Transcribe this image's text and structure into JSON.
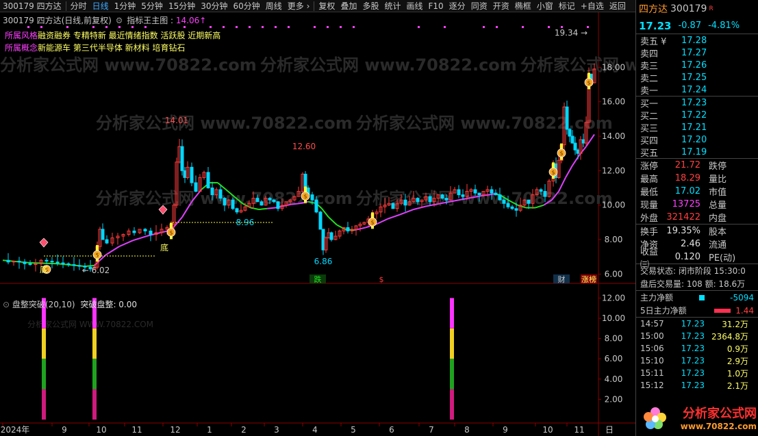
{
  "toolbar": {
    "code_name": "300179 四方达",
    "items": [
      "分时",
      "日线",
      "1分钟",
      "5分钟",
      "15分钟",
      "30分钟",
      "60分钟",
      "周线",
      "更多 ›"
    ],
    "active_index": 1,
    "tools": [
      "复权",
      "叠加",
      "多股",
      "统计",
      "画线",
      "F10",
      "逐分",
      "同资",
      "开资",
      "椭框",
      "小窗",
      "标记",
      "+自选",
      "返回"
    ]
  },
  "chart_header": {
    "title": "300179 四方达(日线,前复权)",
    "indicator_label": "指标王主图 :",
    "indicator_value": "14.06↑"
  },
  "concepts": {
    "style_label": "所属风格",
    "style_tags": "融资融券  专精特新  最近情绪指数  活跃股  近期新高",
    "concept_label": "所属概念",
    "concept_tags": "新能源车  第三代半导体  新材料  培育钻石"
  },
  "chart_data": [
    {
      "type": "candlestick",
      "title": "300179 四方达(日线,前复权)",
      "y_ticks": [
        18.0,
        16.0,
        14.0,
        12.0,
        10.0,
        8.0,
        6.0
      ],
      "ylim": [
        5.5,
        19.6
      ],
      "x_ticks": [
        "2024年",
        "9",
        "10",
        "11",
        "12",
        "1",
        "2",
        "3",
        "4",
        "5",
        "6",
        "7",
        "8",
        "9",
        "10",
        "11",
        "日"
      ],
      "annotations": {
        "high_1": "14.01",
        "high_2": "12.60",
        "low_1": "6.02",
        "low_2": "6.86",
        "support": "8.96",
        "recent_high": "19.34"
      },
      "bottom_labels": [
        "底",
        "底"
      ],
      "event_labels": [
        "跌",
        "$",
        "财",
        "涨榜"
      ],
      "close_path": [
        [
          0,
          6.8
        ],
        [
          8,
          6.7
        ],
        [
          16,
          6.75
        ],
        [
          24,
          6.7
        ],
        [
          32,
          6.6
        ],
        [
          40,
          6.55
        ],
        [
          48,
          6.6
        ],
        [
          56,
          6.8
        ],
        [
          64,
          6.75
        ],
        [
          72,
          6.7
        ],
        [
          80,
          6.65
        ],
        [
          88,
          6.6
        ],
        [
          96,
          6.55
        ],
        [
          104,
          6.5
        ],
        [
          112,
          6.45
        ],
        [
          120,
          6.4
        ],
        [
          128,
          6.3
        ],
        [
          134,
          6.4
        ],
        [
          138,
          7.6
        ],
        [
          142,
          8.6
        ],
        [
          146,
          8.0
        ],
        [
          152,
          7.8
        ],
        [
          160,
          8.1
        ],
        [
          168,
          8.2
        ],
        [
          176,
          8.3
        ],
        [
          184,
          8.5
        ],
        [
          192,
          8.4
        ],
        [
          200,
          8.6
        ],
        [
          208,
          8.5
        ],
        [
          216,
          8.3
        ],
        [
          224,
          8.4
        ],
        [
          232,
          8.6
        ],
        [
          240,
          8.7
        ],
        [
          246,
          8.9
        ],
        [
          250,
          10.0
        ],
        [
          254,
          12.5
        ],
        [
          258,
          13.4
        ],
        [
          262,
          12.0
        ],
        [
          266,
          11.6
        ],
        [
          270,
          12.2
        ],
        [
          276,
          11.3
        ],
        [
          282,
          10.8
        ],
        [
          288,
          11.6
        ],
        [
          294,
          11.9
        ],
        [
          300,
          11.0
        ],
        [
          306,
          10.6
        ],
        [
          312,
          10.9
        ],
        [
          318,
          10.4
        ],
        [
          324,
          10.0
        ],
        [
          330,
          10.3
        ],
        [
          336,
          9.8
        ],
        [
          342,
          9.6
        ],
        [
          348,
          9.7
        ],
        [
          354,
          9.9
        ],
        [
          360,
          10.1
        ],
        [
          366,
          10.4
        ],
        [
          372,
          10.2
        ],
        [
          378,
          10.0
        ],
        [
          384,
          10.4
        ],
        [
          390,
          10.3
        ],
        [
          396,
          10.2
        ],
        [
          402,
          9.8
        ],
        [
          408,
          10.0
        ],
        [
          414,
          10.2
        ],
        [
          420,
          10.3
        ],
        [
          426,
          10.5
        ],
        [
          432,
          10.8
        ],
        [
          438,
          11.8
        ],
        [
          442,
          11.0
        ],
        [
          446,
          10.6
        ],
        [
          452,
          10.3
        ],
        [
          458,
          9.6
        ],
        [
          464,
          8.6
        ],
        [
          468,
          7.4
        ],
        [
          472,
          8.1
        ],
        [
          476,
          8.4
        ],
        [
          480,
          8.0
        ],
        [
          486,
          8.2
        ],
        [
          492,
          8.5
        ],
        [
          498,
          8.7
        ],
        [
          504,
          8.5
        ],
        [
          510,
          8.6
        ],
        [
          516,
          8.8
        ],
        [
          522,
          8.9
        ],
        [
          528,
          9.0
        ],
        [
          534,
          9.2
        ],
        [
          540,
          9.5
        ],
        [
          546,
          9.6
        ],
        [
          552,
          9.9
        ],
        [
          558,
          10.0
        ],
        [
          564,
          10.1
        ],
        [
          570,
          9.8
        ],
        [
          576,
          10.1
        ],
        [
          582,
          10.3
        ],
        [
          588,
          10.0
        ],
        [
          594,
          10.2
        ],
        [
          600,
          10.4
        ],
        [
          606,
          10.2
        ],
        [
          612,
          10.3
        ],
        [
          618,
          10.5
        ],
        [
          624,
          10.2
        ],
        [
          630,
          10.4
        ],
        [
          636,
          10.6
        ],
        [
          642,
          10.4
        ],
        [
          648,
          10.3
        ],
        [
          654,
          10.7
        ],
        [
          660,
          10.9
        ],
        [
          666,
          10.6
        ],
        [
          672,
          10.5
        ],
        [
          678,
          10.8
        ],
        [
          684,
          10.9
        ],
        [
          690,
          10.7
        ],
        [
          696,
          10.6
        ],
        [
          702,
          10.8
        ],
        [
          708,
          10.9
        ],
        [
          714,
          10.7
        ],
        [
          720,
          10.6
        ],
        [
          726,
          10.3
        ],
        [
          732,
          10.1
        ],
        [
          738,
          9.9
        ],
        [
          744,
          9.8
        ],
        [
          750,
          9.7
        ],
        [
          756,
          10.0
        ],
        [
          762,
          10.3
        ],
        [
          768,
          10.1
        ],
        [
          774,
          10.6
        ],
        [
          780,
          10.9
        ],
        [
          786,
          10.8
        ],
        [
          792,
          10.5
        ],
        [
          798,
          11.4
        ],
        [
          804,
          12.4
        ],
        [
          808,
          11.6
        ],
        [
          812,
          12.6
        ],
        [
          816,
          13.5
        ],
        [
          820,
          15.7
        ],
        [
          824,
          14.4
        ],
        [
          828,
          14.0
        ],
        [
          832,
          13.6
        ],
        [
          836,
          13.2
        ],
        [
          840,
          13.0
        ],
        [
          844,
          13.8
        ],
        [
          848,
          13.6
        ],
        [
          852,
          14.8
        ],
        [
          856,
          17.6
        ],
        [
          860,
          17.1
        ],
        [
          864,
          17.9
        ]
      ],
      "ma_line": [
        [
          0,
          6.8
        ],
        [
          40,
          6.65
        ],
        [
          80,
          6.6
        ],
        [
          120,
          6.45
        ],
        [
          134,
          6.5
        ],
        [
          150,
          7.1
        ],
        [
          170,
          7.6
        ],
        [
          190,
          7.95
        ],
        [
          210,
          8.2
        ],
        [
          230,
          8.4
        ],
        [
          246,
          8.55
        ],
        [
          262,
          9.3
        ],
        [
          276,
          10.2
        ],
        [
          290,
          10.9
        ],
        [
          302,
          11.3
        ],
        [
          314,
          11.3
        ],
        [
          326,
          10.9
        ],
        [
          338,
          10.5
        ],
        [
          350,
          10.1
        ],
        [
          362,
          9.85
        ],
        [
          374,
          9.75
        ],
        [
          386,
          9.8
        ],
        [
          398,
          9.85
        ],
        [
          410,
          9.95
        ],
        [
          422,
          10.05
        ],
        [
          434,
          10.1
        ],
        [
          446,
          10.2
        ],
        [
          458,
          10.1
        ],
        [
          466,
          9.8
        ],
        [
          476,
          9.3
        ],
        [
          488,
          8.85
        ],
        [
          500,
          8.6
        ],
        [
          514,
          8.55
        ],
        [
          530,
          8.7
        ],
        [
          546,
          8.9
        ],
        [
          562,
          9.2
        ],
        [
          580,
          9.45
        ],
        [
          600,
          9.75
        ],
        [
          620,
          9.95
        ],
        [
          640,
          10.1
        ],
        [
          660,
          10.25
        ],
        [
          680,
          10.4
        ],
        [
          700,
          10.55
        ],
        [
          718,
          10.65
        ],
        [
          726,
          10.6
        ],
        [
          738,
          10.3
        ],
        [
          752,
          10.0
        ],
        [
          764,
          9.85
        ],
        [
          778,
          9.85
        ],
        [
          790,
          10.0
        ],
        [
          802,
          10.3
        ],
        [
          812,
          10.8
        ],
        [
          822,
          11.6
        ],
        [
          832,
          12.3
        ],
        [
          842,
          12.9
        ],
        [
          852,
          13.4
        ],
        [
          864,
          14.1
        ]
      ],
      "ma_green_ranges": [
        [
          0,
          134
        ],
        [
          290,
          380
        ],
        [
          446,
          516
        ],
        [
          718,
          790
        ]
      ],
      "last_price": 17.23,
      "signals_x": [
        60,
        138,
        246,
        440,
        540,
        800,
        814,
        856
      ],
      "limit_up_x": [
        138,
        246,
        440,
        540,
        800,
        814,
        856
      ],
      "diamonds_x": [
        60,
        234
      ]
    },
    {
      "type": "bar",
      "title": "盘整突破(20,10)  突破盘整: 0.00",
      "y_ticks": [
        12.0,
        10.0,
        8.0,
        6.0,
        4.0,
        2.0
      ],
      "ylim": [
        0,
        12.5
      ],
      "bars_x": [
        60,
        134,
        656
      ],
      "bar_value": 12,
      "segments": [
        {
          "upto": 3,
          "color": "#d01a7e"
        },
        {
          "upto": 6,
          "color": "#1fa31f"
        },
        {
          "upto": 9,
          "color": "#f0d020"
        },
        {
          "upto": 12,
          "color": "#ff33ff"
        }
      ]
    }
  ],
  "panel2_title": "盘整突破(20,10)",
  "panel2_value": "突破盘整: 0.00",
  "watermark": "分析家公式网   WWW.70822.COM",
  "right_panel": {
    "name": "四方达",
    "code": "300179",
    "r_badge": "R",
    "last": "17.23",
    "change": "-0.87",
    "pct": "-4.81%",
    "sells": [
      {
        "label": "卖五 ¥",
        "price": "17.28"
      },
      {
        "label": "卖四",
        "price": "17.27"
      },
      {
        "label": "卖三",
        "price": "17.26"
      },
      {
        "label": "卖二",
        "price": "17.25"
      },
      {
        "label": "卖一",
        "price": "17.24"
      }
    ],
    "buys": [
      {
        "label": "买一",
        "price": "17.23"
      },
      {
        "label": "买二",
        "price": "17.22"
      },
      {
        "label": "买三",
        "price": "17.21"
      },
      {
        "label": "买四",
        "price": "17.20"
      },
      {
        "label": "买五",
        "price": "17.19"
      }
    ],
    "stats1": [
      {
        "l1": "涨停",
        "v1": "21.72",
        "c1": "red",
        "l2": "跌停"
      },
      {
        "l1": "最高",
        "v1": "18.29",
        "c1": "red",
        "l2": "量比"
      },
      {
        "l1": "最低",
        "v1": "17.02",
        "c1": "cyan",
        "l2": "市值"
      },
      {
        "l1": "现量",
        "v1": "13725",
        "c1": "mag2",
        "l2": "总量"
      },
      {
        "l1": "外盘",
        "v1": "321422",
        "c1": "red",
        "l2": "内盘"
      }
    ],
    "stats2": [
      {
        "l1": "换手",
        "v1": "19.35%",
        "c1": "white",
        "l2": "股本"
      },
      {
        "l1": "净资",
        "v1": "2.46",
        "c1": "white",
        "l2": "流通"
      },
      {
        "l1": "收益㈢",
        "v1": "0.120",
        "c1": "white",
        "l2": "PE(动)"
      }
    ],
    "trade_status": "交易状态: 闭市阶段 15:30:0",
    "after_hours": "盘后交易量: 108  额: 18.6万",
    "main_flow_label": "主力净额",
    "main_flow_value": "-5094",
    "main5_label": "5日主力净额",
    "main5_value": "1.44",
    "ticks": [
      {
        "t": "14:57",
        "p": "17.23",
        "q": "31.2万"
      },
      {
        "t": "15:00",
        "p": "17.23",
        "q": "2364.8万"
      },
      {
        "t": "15:06",
        "p": "17.23",
        "q": "0.9万"
      },
      {
        "t": "15:10",
        "p": "17.23",
        "q": "2.9万"
      },
      {
        "t": "15:11",
        "p": "17.23",
        "q": "1.0万"
      },
      {
        "t": "15:12",
        "p": "17.23",
        "q": "2.1万"
      }
    ],
    "logo_text": "分析家公式网",
    "logo_url": "www.70822.com"
  }
}
